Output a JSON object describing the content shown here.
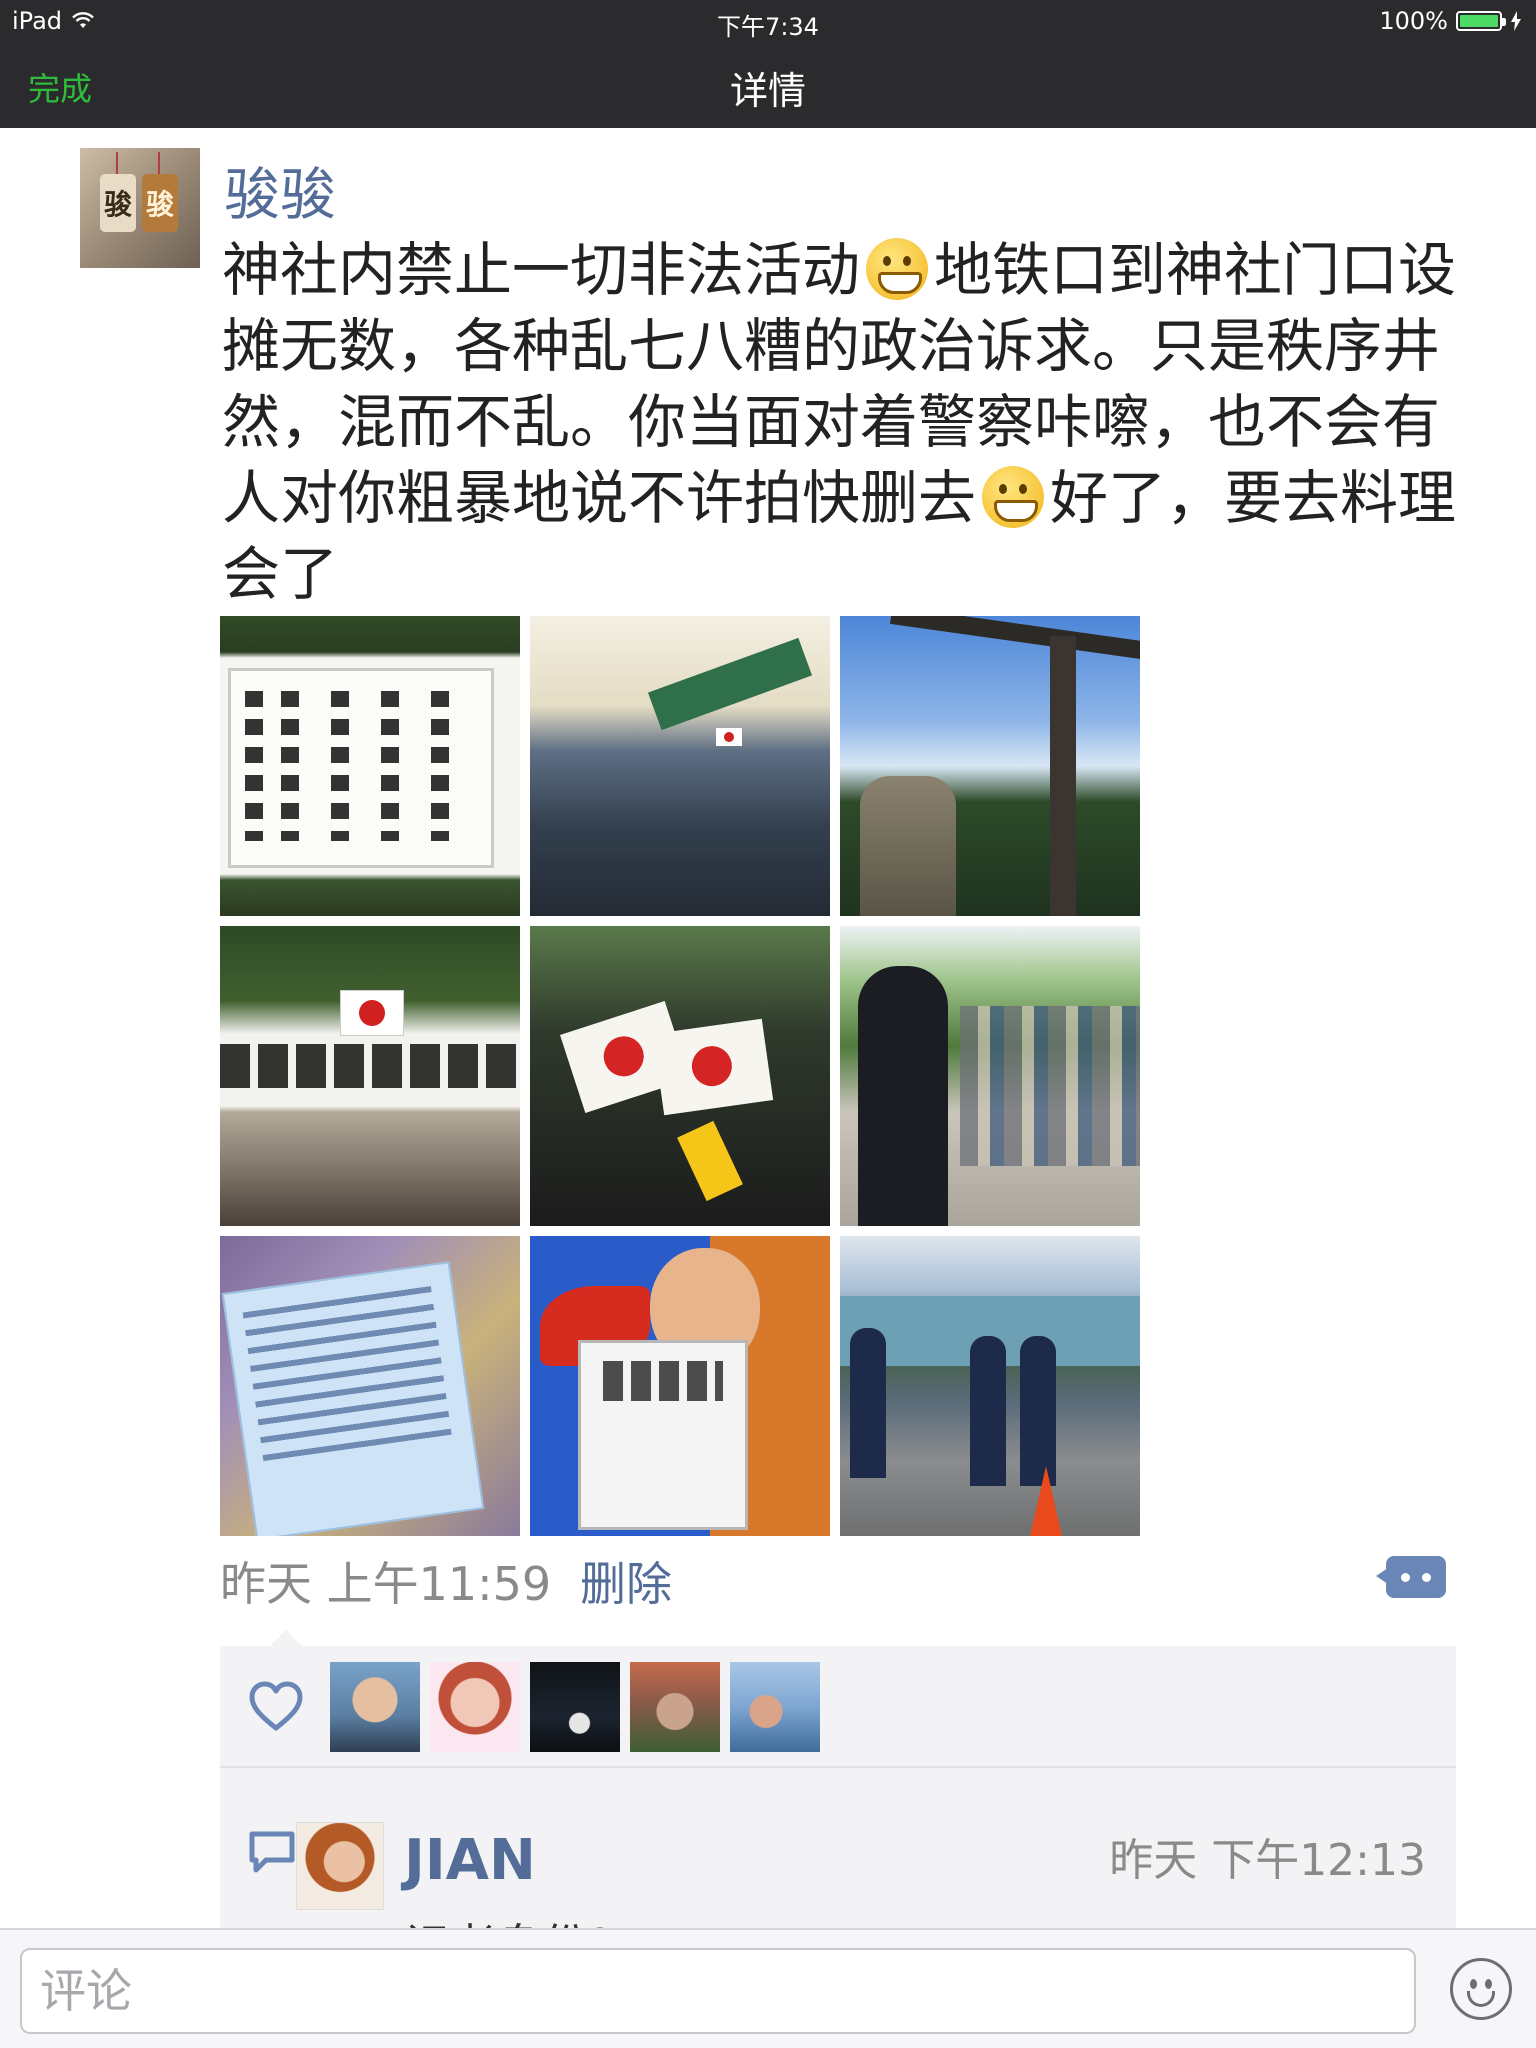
{
  "status_bar": {
    "device": "iPad",
    "time": "下午7:34",
    "battery": "100%",
    "battery_level": 1.0
  },
  "nav": {
    "done_label": "完成",
    "title": "详情"
  },
  "post": {
    "author": "骏骏",
    "text_parts": [
      "神社内禁止一切非法活动",
      "地铁口到神社门口设摊无数，各种乱七八糟的政治诉求。只是秩序井然，混而不乱。你当面对着警察咔嚓，也不会有人对你粗暴地说不许拍快删去",
      "好了，要去料理会了"
    ],
    "photos": [
      "shrine-rules-sign",
      "rally-under-tent",
      "torii-gate-and-lantern",
      "banner-with-japanese-flag",
      "japanese-flags-crowd",
      "man-in-suit-and-crowd",
      "handout-flyer",
      "man-holding-sign",
      "police-line-with-cone"
    ],
    "time": "昨天 上午11:59",
    "delete_label": "删除"
  },
  "likes": {
    "icon": "heart-icon",
    "avatars": [
      "liker-1",
      "liker-2",
      "liker-3",
      "liker-4",
      "liker-5"
    ]
  },
  "comments": [
    {
      "name": "JIAN",
      "time": "昨天 下午12:13",
      "text": "记者身份?"
    }
  ],
  "input": {
    "placeholder": "评论"
  },
  "colors": {
    "bar_background": "#2b2b2e",
    "done_green": "#2ebd3a",
    "name_blue": "#546c98",
    "time_gray": "#8a8a8a",
    "panel_background": "#f3f3f6"
  }
}
